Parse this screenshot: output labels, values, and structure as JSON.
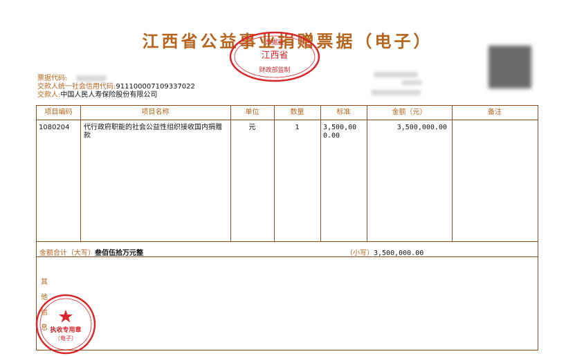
{
  "title": "江西省公益事业捐赠票据（电子）",
  "seal_top": {
    "line1": "票据监",
    "line2": "江西省",
    "line3": "财政部监制"
  },
  "meta": {
    "code_label": "票据代码:",
    "payer_credit_label": "交款人统一社会信用代码:",
    "payer_credit_value": "911100007109337022",
    "payer_label": "交款人:",
    "payer_value": "中国人民人寿保险股份有限公司"
  },
  "table": {
    "headers": [
      "项目编码",
      "项目名称",
      "单位",
      "数量",
      "标准",
      "金额（元）",
      "备注"
    ],
    "rows": [
      {
        "code": "1080204",
        "name": "代行政府职能的社会公益性组织接收国内捐赠款",
        "unit": "元",
        "qty": "1",
        "standard": "3,500,000.00",
        "amount": "3,500,000.00",
        "note": ""
      }
    ],
    "total_label": "金额合计（大写）",
    "total_upper": "叁佰伍拾万元整",
    "total_small_label": "（小写）",
    "total_small": "3,500,000.00"
  },
  "other": {
    "chars": [
      "其",
      "他",
      "信",
      "息"
    ]
  },
  "seal_bottom": {
    "text1": "执收专用章",
    "text2": "（电子）"
  },
  "colors": {
    "label": "#b5651d",
    "border": "#8b4a1a",
    "seal": "#d9262a"
  }
}
